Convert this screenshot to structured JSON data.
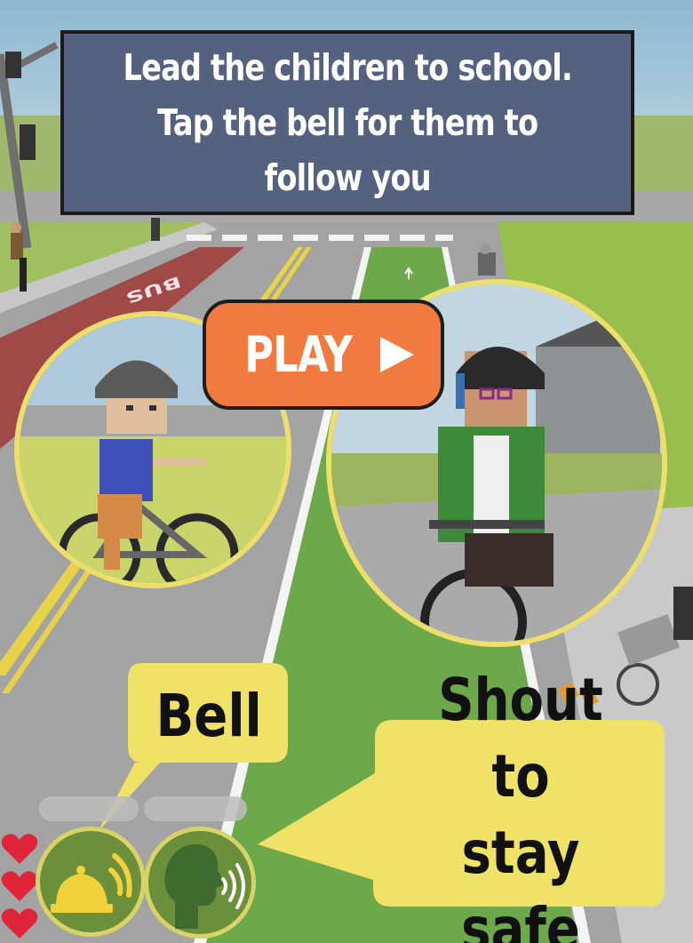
{
  "instruction": {
    "text": "Lead the children to school.\nTap the bell for them to\nfollow you"
  },
  "play_button": {
    "label": "PLAY"
  },
  "road_marking": {
    "text": "BUS"
  },
  "bell_bubble": {
    "label": "Bell"
  },
  "shout_bubble": {
    "label": "Shout to\nstay safe"
  },
  "hud": {
    "lives": 3,
    "heart_color": "#e0243a",
    "bell_button_icon": "bell-icon",
    "shout_button_icon": "shout-icon"
  },
  "colors": {
    "banner": "#55627f",
    "play": "#f07a3f",
    "bubble": "#efe267",
    "circle_border": "#ecdf6b",
    "bike_lane": "#6da84a"
  }
}
